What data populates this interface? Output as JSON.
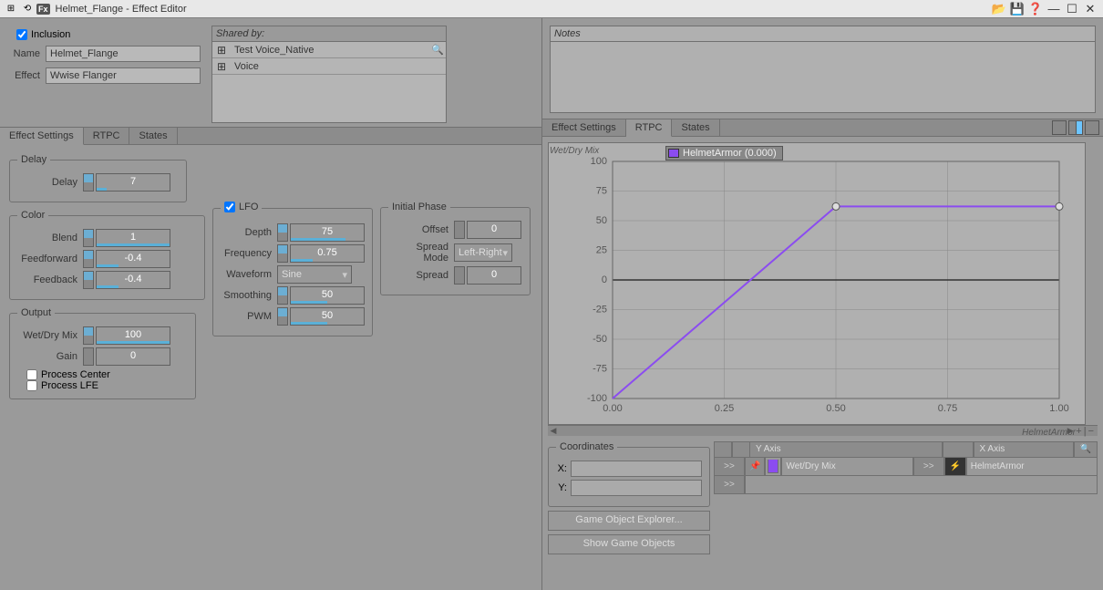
{
  "window": {
    "title": "Helmet_Flange - Effect Editor"
  },
  "info": {
    "inclusion_label": "Inclusion",
    "inclusion_checked": true,
    "name_label": "Name",
    "name_value": "Helmet_Flange",
    "effect_label": "Effect",
    "effect_value": "Wwise Flanger",
    "shared_by_label": "Shared by:",
    "shared_items": [
      {
        "label": "Test Voice_Native"
      },
      {
        "label": "Voice"
      }
    ],
    "notes_label": "Notes"
  },
  "tabs": {
    "effect_settings": "Effect Settings",
    "rtpc": "RTPC",
    "states": "States"
  },
  "params": {
    "delay_section": "Delay",
    "delay_label": "Delay",
    "delay_value": "7",
    "color_section": "Color",
    "blend_label": "Blend",
    "blend_value": "1",
    "feedforward_label": "Feedforward",
    "feedforward_value": "-0.4",
    "feedback_label": "Feedback",
    "feedback_value": "-0.4",
    "lfo_section": "LFO",
    "lfo_checked": true,
    "depth_label": "Depth",
    "depth_value": "75",
    "frequency_label": "Frequency",
    "frequency_value": "0.75",
    "waveform_label": "Waveform",
    "waveform_value": "Sine",
    "smoothing_label": "Smoothing",
    "smoothing_value": "50",
    "pwm_label": "PWM",
    "pwm_value": "50",
    "phase_section": "Initial Phase",
    "offset_label": "Offset",
    "offset_value": "0",
    "spread_mode_label": "Spread Mode",
    "spread_mode_value": "Left-Right",
    "spread_label": "Spread",
    "spread_value": "0",
    "output_section": "Output",
    "wetdry_label": "Wet/Dry Mix",
    "wetdry_value": "100",
    "gain_label": "Gain",
    "gain_value": "0",
    "process_center_label": "Process Center",
    "process_lfe_label": "Process LFE"
  },
  "chart_data": {
    "type": "line",
    "title": "",
    "legend": "HelmetArmor (0.000)",
    "xlabel": "HelmetArmor",
    "ylabel": "Wet/Dry Mix",
    "x": [
      0.0,
      0.5,
      1.0
    ],
    "y": [
      -100,
      62,
      62
    ],
    "xlim": [
      0.0,
      1.0
    ],
    "ylim": [
      -100,
      100
    ],
    "xticks": [
      "0.00",
      "0.25",
      "0.50",
      "0.75",
      "1.00"
    ],
    "yticks": [
      "100",
      "75",
      "50",
      "25",
      "0",
      "-25",
      "-50",
      "-75",
      "-100"
    ]
  },
  "coords": {
    "section": "Coordinates",
    "x_label": "X:",
    "y_label": "Y:"
  },
  "axes": {
    "yaxis_header": "Y Axis",
    "xaxis_header": "X Axis",
    "y_name": "Wet/Dry Mix",
    "x_name": "HelmetArmor",
    "go_btn": ">>",
    "search_icon": "🔍"
  },
  "buttons": {
    "game_object_explorer": "Game Object Explorer...",
    "show_game_objects": "Show Game Objects"
  }
}
